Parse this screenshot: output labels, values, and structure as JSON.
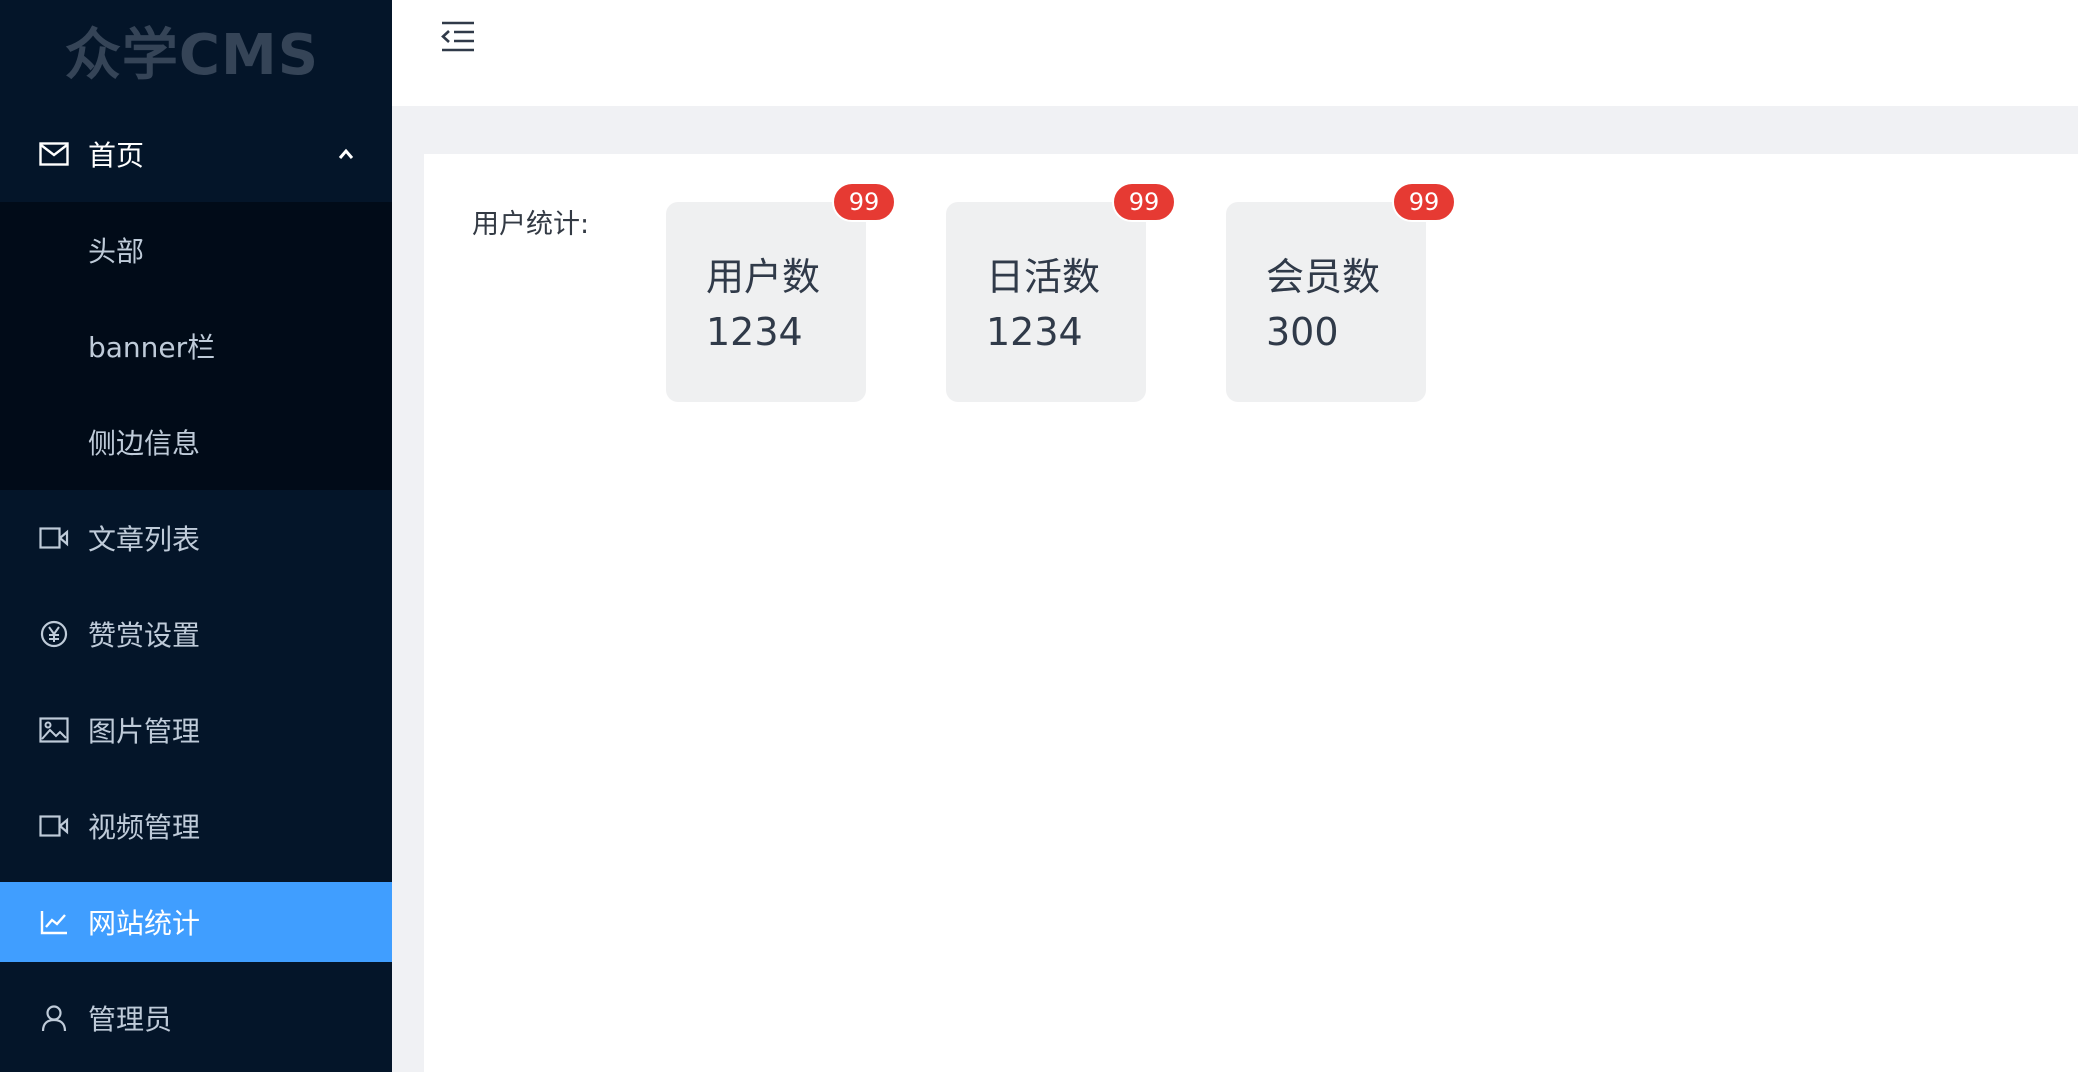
{
  "app": {
    "logo_text": "众学CMS"
  },
  "header": {
    "collapse_icon": "indent-collapse-icon"
  },
  "sidebar": {
    "items": [
      {
        "label": "首页",
        "icon": "mail-icon",
        "expanded": true,
        "children": [
          {
            "label": "头部"
          },
          {
            "label": "banner栏"
          },
          {
            "label": "侧边信息"
          }
        ]
      },
      {
        "label": "文章列表",
        "icon": "video-camera-icon"
      },
      {
        "label": "赞赏设置",
        "icon": "yen-circle-icon"
      },
      {
        "label": "图片管理",
        "icon": "picture-icon"
      },
      {
        "label": "视频管理",
        "icon": "video-camera-icon"
      },
      {
        "label": "网站统计",
        "icon": "line-chart-icon",
        "active": true
      },
      {
        "label": "管理员",
        "icon": "user-icon"
      }
    ]
  },
  "main": {
    "stat_title": "用户统计:",
    "cards": [
      {
        "name": "用户数",
        "value": "1234",
        "badge": "99"
      },
      {
        "name": "日活数",
        "value": "1234",
        "badge": "99"
      },
      {
        "name": "会员数",
        "value": "300",
        "badge": "99"
      }
    ]
  },
  "colors": {
    "sidebar_bg": "#041529",
    "submenu_bg": "#010b18",
    "active_item": "#409eff",
    "badge": "#e63a33",
    "content_bg": "#f0f1f4"
  }
}
